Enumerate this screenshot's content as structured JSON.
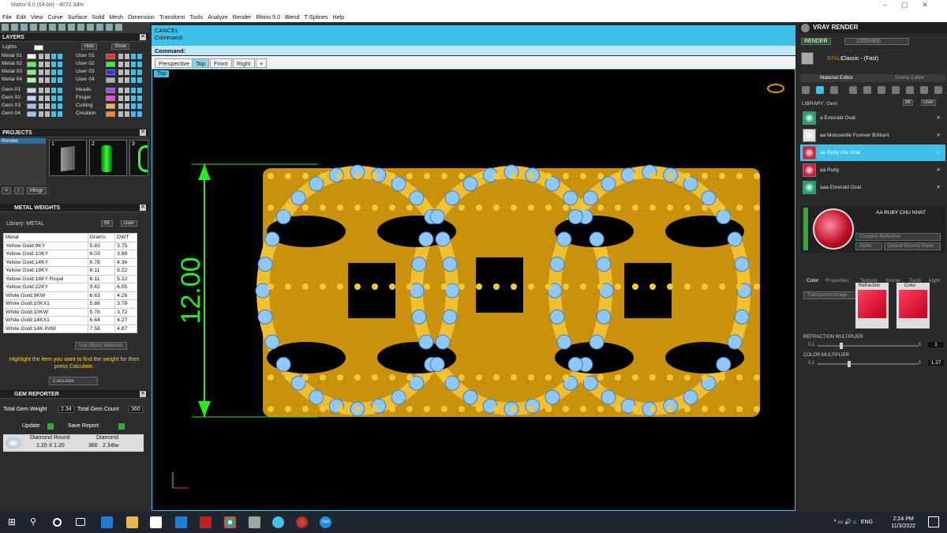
{
  "window": {
    "title": "Matrix 8.0 (64-bit) - 4072.3dm"
  },
  "menu": [
    "File",
    "Edit",
    "View",
    "Curve",
    "Surface",
    "Solid",
    "Mesh",
    "Dimension",
    "Transform",
    "Tools",
    "Analyze",
    "Render",
    "Rhino 5.0",
    "Blend",
    "T-Splines",
    "Help"
  ],
  "layers": {
    "title": "LAYERS",
    "lights": "Lights",
    "hide": "Hide",
    "show": "Show",
    "left": [
      {
        "label": "Metal 01",
        "color": "#ffffff"
      },
      {
        "label": "Metal 02",
        "color": "#5aff5a"
      },
      {
        "label": "Metal 03",
        "color": "#7dff7d"
      },
      {
        "label": "Metal 04",
        "color": "#aaffaa"
      },
      {
        "label": "Gem 01",
        "color": "#d0d0ff"
      },
      {
        "label": "Gem 02",
        "color": "#d0d0ff"
      },
      {
        "label": "Gem 03",
        "color": "#a0c0ff"
      },
      {
        "label": "Gem 04",
        "color": "#a0c0ff"
      }
    ],
    "right": [
      {
        "label": "User 01",
        "color": "#ff3030"
      },
      {
        "label": "User 02",
        "color": "#30ff30"
      },
      {
        "label": "User 03",
        "color": "#3030ff"
      },
      {
        "label": "User 04",
        "color": "#b0b0b0"
      },
      {
        "label": "Heads",
        "color": "#b040ff"
      },
      {
        "label": "Finger",
        "color": "#ff40ff"
      },
      {
        "label": "Cutting",
        "color": "#ffb040"
      },
      {
        "label": "Creation",
        "color": "#ff8a1a"
      }
    ]
  },
  "projects": {
    "title": "PROJECTS",
    "items": [
      "Render"
    ],
    "thumbs": [
      "1",
      "2",
      "3"
    ],
    "hingr": "Hingr"
  },
  "metal": {
    "title": "METAL WEIGHTS",
    "library_label": "Library: METAL",
    "mode_9k": "9K",
    "user": "User",
    "columns": [
      "Metal",
      "Grams",
      "DWT"
    ],
    "rows": [
      [
        "Yellow Gold:9KY",
        "5.83",
        "3.75"
      ],
      [
        "Yellow Gold:10KY",
        "6.03",
        "3.88"
      ],
      [
        "Yellow Gold:14KY",
        "6.78",
        "4.36"
      ],
      [
        "Yellow Gold:18KY",
        "8.11",
        "5.22"
      ],
      [
        "Yellow Gold:18KY Royal",
        "8.11",
        "5.22"
      ],
      [
        "Yellow Gold:22KY",
        "9.42",
        "6.05"
      ],
      [
        "White Gold:9KW",
        "6.63",
        "4.26"
      ],
      [
        "White Gold:10KX1",
        "5.88",
        "3.78"
      ],
      [
        "White Gold:10KW",
        "5.78",
        "3.72"
      ],
      [
        "White Gold:14KX1",
        "6.64",
        "4.27"
      ],
      [
        "White Gold:14K PdW",
        "7.58",
        "4.87"
      ]
    ],
    "use_object_materials": "Use Object Materials",
    "hint": "Highlight the item you want to find the weight for then press Calculate.",
    "calculate": "Calculate"
  },
  "gem": {
    "title": "GEM REPORTER",
    "total_weight_label": "Total Gem Weight",
    "total_weight": "2.34",
    "total_count_label": "Total Gem Count",
    "total_count": "360",
    "update": "Update",
    "save_report": "Save Report",
    "row": {
      "shape": "Diamond Round",
      "material": "Diamond",
      "size": "1.20 X 1.20",
      "count": "360",
      "weight": "2.34tw"
    }
  },
  "command": {
    "line1": "CANCEL",
    "line2": "Command:",
    "prompt": "Command:"
  },
  "view_tabs": [
    "Perspective",
    "Top",
    "Front",
    "Right",
    "+"
  ],
  "active_view": "Top",
  "viewport": {
    "label": "Top",
    "dimension": "12.00"
  },
  "vray": {
    "title": "VRAY RENDER",
    "render": "RENDER",
    "resolution": "1200x900",
    "style_label": "STYLE:",
    "style_value": "Classic - (Fast)",
    "tab_material": "Material Editor",
    "tab_scene": "Scene Editor",
    "library": "LIBRARY: Gem",
    "lib_9k": "9K",
    "lib_user": "User",
    "materials": [
      {
        "name": "a Emerald Oval",
        "color": "#1aa56a"
      },
      {
        "name": "aa Moissanite Forever Brilliant",
        "color": "#e0e0e0"
      },
      {
        "name": "aa Ruby chu nhat",
        "color": "#d21a3a"
      },
      {
        "name": "aa Ruby",
        "color": "#d21a3a"
      },
      {
        "name": "aaa Emerald Oval",
        "color": "#1aa56a"
      }
    ],
    "preview_name": "AA RUBY CHU NHAT",
    "reflection": "Complex Reflection",
    "alpha": "Alpha",
    "ground": "Default Ground Plane",
    "sub_tabs": [
      "Color",
      "Properties",
      "Texture",
      "Scene",
      "Tools",
      "Light"
    ],
    "transparent": "Transparent Image",
    "refraction": "Refraction",
    "color": "Color",
    "refraction_mult_label": "REFRACTION MULTIPLIER",
    "refraction_min": "0.1",
    "refraction_max": "5",
    "refraction_val": "1",
    "color_mult_label": "COLOR MULTIPLIER",
    "color_min": "0.1",
    "color_max": "5",
    "color_val": "1.37"
  },
  "taskbar": {
    "time": "2:24 PM",
    "date": "11/3/2022",
    "lang": "ENG"
  }
}
